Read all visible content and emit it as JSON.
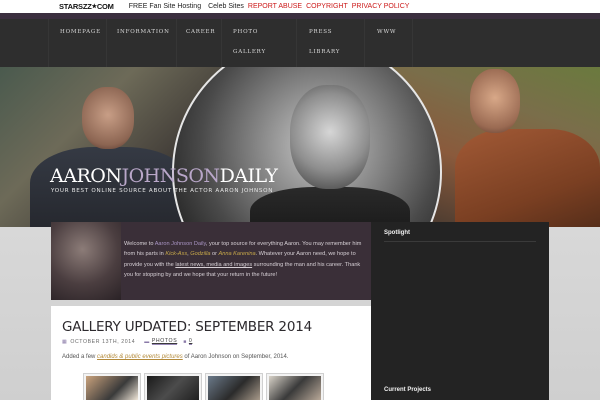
{
  "topbar": {
    "logo_text": "STARSZZ",
    "logo_suffix": "COM",
    "links": [
      {
        "label": "FREE Fan Site Hosting",
        "color": "#222222"
      },
      {
        "label": "Celeb Sites",
        "color": "#222222"
      },
      {
        "label": "REPORT ABUSE",
        "color": "#cc1a1a"
      },
      {
        "label": "COPYRIGHT",
        "color": "#cc1a1a"
      },
      {
        "label": "PRIVACY POLICY",
        "color": "#cc1a1a"
      }
    ]
  },
  "nav": {
    "items": [
      {
        "label": "Homepage"
      },
      {
        "label": "Information"
      },
      {
        "label": "Career"
      },
      {
        "label": "Photo"
      },
      {
        "label": "Gallery"
      },
      {
        "label": "Press"
      },
      {
        "label": "Library"
      },
      {
        "label": "WWW"
      }
    ]
  },
  "header": {
    "brand_part1": "AARON",
    "brand_part2": "JOHNSON",
    "brand_part3": "DAILY",
    "tagline": "Your best online source about the actor Aaron Johnson"
  },
  "welcome": {
    "t1": "Welcome to ",
    "site_name": "Aaron Johnson Daily",
    "t2": ", your top source for everything Aaron. You may remember him from his parts in ",
    "film1": "Kick-Ass",
    "t3": ", ",
    "film2": "Godzilla",
    "t4": " or ",
    "film3": "Anna Karenina",
    "t5": ". Whatever your Aaron need, we hope to provide you with the ",
    "link": "latest news, media and images",
    "t6": " surrounding the man and his career. Thank you for stopping by and we hope that your return in the future!"
  },
  "sidebar": {
    "spotlight": "Spotlight",
    "current_projects": "Current Projects"
  },
  "post": {
    "title": "GALLERY UPDATED: SEPTEMBER 2014",
    "date": "OCTOBER 13TH, 2014",
    "category": "PHOTOS",
    "comments": "0",
    "body_before": "Added a few ",
    "body_link": "candids & public events pictures",
    "body_after": " of Aaron Johnson on September, 2014."
  },
  "colors": {
    "accent_purple": "#b9a7c9",
    "nav_bg": "#2e2e2e",
    "welcome_bg": "#3a2f38",
    "sidebar_bg": "#232323",
    "report_red": "#cc1a1a"
  }
}
